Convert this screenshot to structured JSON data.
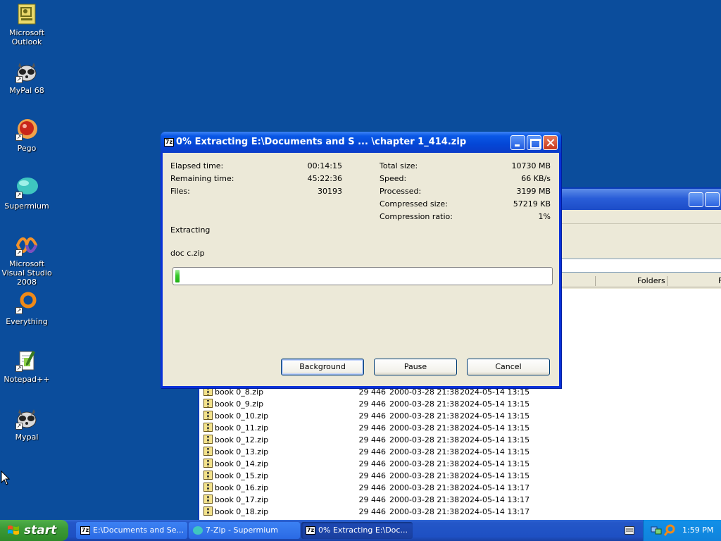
{
  "desktop": {
    "icons": [
      {
        "label": "Microsoft Outlook",
        "icon": "outlook-icon"
      },
      {
        "label": "MyPal 68",
        "icon": "mypal-icon"
      },
      {
        "label": "Pego",
        "icon": "pego-icon"
      },
      {
        "label": "Supermium",
        "icon": "supermium-icon"
      },
      {
        "label": "Microsoft Visual Studio 2008",
        "icon": "visual-studio-icon"
      },
      {
        "label": "Everything",
        "icon": "everything-icon"
      },
      {
        "label": "Notepad++",
        "icon": "notepadpp-icon"
      },
      {
        "label": "Mypal",
        "icon": "mypal-icon"
      }
    ]
  },
  "file_manager": {
    "column_headers": {
      "folders": "Folders",
      "next": "F"
    },
    "rows": [
      {
        "name": "book 0_8.zip",
        "size": "29 446",
        "modified": "2000-03-28 21:38",
        "created": "2024-05-14 13:15"
      },
      {
        "name": "book 0_9.zip",
        "size": "29 446",
        "modified": "2000-03-28 21:38",
        "created": "2024-05-14 13:15"
      },
      {
        "name": "book 0_10.zip",
        "size": "29 446",
        "modified": "2000-03-28 21:38",
        "created": "2024-05-14 13:15"
      },
      {
        "name": "book 0_11.zip",
        "size": "29 446",
        "modified": "2000-03-28 21:38",
        "created": "2024-05-14 13:15"
      },
      {
        "name": "book 0_12.zip",
        "size": "29 446",
        "modified": "2000-03-28 21:38",
        "created": "2024-05-14 13:15"
      },
      {
        "name": "book 0_13.zip",
        "size": "29 446",
        "modified": "2000-03-28 21:38",
        "created": "2024-05-14 13:15"
      },
      {
        "name": "book 0_14.zip",
        "size": "29 446",
        "modified": "2000-03-28 21:38",
        "created": "2024-05-14 13:15"
      },
      {
        "name": "book 0_15.zip",
        "size": "29 446",
        "modified": "2000-03-28 21:38",
        "created": "2024-05-14 13:15"
      },
      {
        "name": "book 0_16.zip",
        "size": "29 446",
        "modified": "2000-03-28 21:38",
        "created": "2024-05-14 13:17"
      },
      {
        "name": "book 0_17.zip",
        "size": "29 446",
        "modified": "2000-03-28 21:38",
        "created": "2024-05-14 13:17"
      },
      {
        "name": "book 0_18.zip",
        "size": "29 446",
        "modified": "2000-03-28 21:38",
        "created": "2024-05-14 13:17"
      }
    ]
  },
  "dialog": {
    "title": "0% Extracting E:\\Documents and S ... \\chapter 1_414.zip",
    "app_badge": "7z",
    "stats_left": [
      {
        "label": "Elapsed time:",
        "value": "00:14:15"
      },
      {
        "label": "Remaining time:",
        "value": "45:22:36"
      },
      {
        "label": "Files:",
        "value": "30193"
      }
    ],
    "stats_right": [
      {
        "label": "Total size:",
        "value": "10730 MB"
      },
      {
        "label": "Speed:",
        "value": "66 KB/s"
      },
      {
        "label": "Processed:",
        "value": "3199 MB"
      },
      {
        "label": "Compressed size:",
        "value": "57219 KB"
      },
      {
        "label": "Compression ratio:",
        "value": "1%"
      }
    ],
    "operation": "Extracting",
    "current_file": "doc c.zip",
    "progress_fraction": 0.01,
    "buttons": {
      "background": "Background",
      "pause": "Pause",
      "cancel": "Cancel"
    }
  },
  "taskbar": {
    "start_label": "start",
    "tasks": [
      {
        "label": "E:\\Documents and Se...",
        "icon": "7zip-icon",
        "badge": "7z"
      },
      {
        "label": "7-Zip - Supermium",
        "icon": "supermium-icon"
      },
      {
        "label": "0% Extracting E:\\Doc...",
        "icon": "7zip-icon",
        "badge": "7z"
      }
    ],
    "clock": "1:59 PM"
  }
}
